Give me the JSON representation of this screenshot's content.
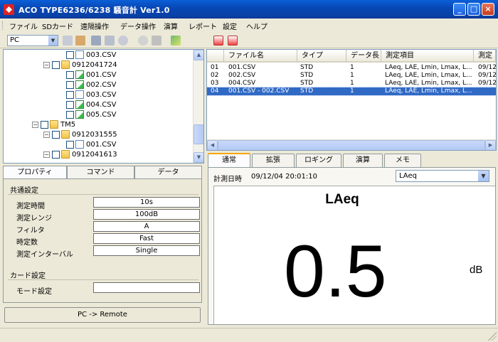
{
  "window": {
    "title": "ACO TYPE6236/6238 騒音計 Ver1.0",
    "min": "_",
    "max": "□",
    "close": "×"
  },
  "menu": [
    "ファイル",
    "SDカード",
    "遠隔操作",
    "データ操作",
    "演算",
    "レポート",
    "設定",
    "ヘルプ"
  ],
  "toolbar": {
    "source_select": "PC"
  },
  "tree": [
    {
      "label": "003.CSV",
      "type": "file",
      "level": 3
    },
    {
      "label": "0912041724",
      "type": "folder",
      "level": 2,
      "expander": "−"
    },
    {
      "label": "001.CSV",
      "type": "file-green",
      "level": 3
    },
    {
      "label": "002.CSV",
      "type": "file-green",
      "level": 3
    },
    {
      "label": "003.CSV",
      "type": "file",
      "level": 3
    },
    {
      "label": "004.CSV",
      "type": "file-green",
      "level": 3
    },
    {
      "label": "005.CSV",
      "type": "file-green",
      "level": 3
    },
    {
      "label": "TM5",
      "type": "folder",
      "level": 1,
      "expander": "−"
    },
    {
      "label": "0912031555",
      "type": "folder",
      "level": 2,
      "expander": "−"
    },
    {
      "label": "001.CSV",
      "type": "file",
      "level": 3
    },
    {
      "label": "0912041613",
      "type": "folder",
      "level": 2,
      "expander": "−"
    }
  ],
  "left_tabs": [
    "プロパティ",
    "コマンド",
    "データ"
  ],
  "properties": {
    "common_group": "共通設定",
    "rows": [
      {
        "label": "測定時間",
        "value": "10s"
      },
      {
        "label": "測定レンジ",
        "value": "100dB"
      },
      {
        "label": "フィルタ",
        "value": "A"
      },
      {
        "label": "時定数",
        "value": "Fast"
      },
      {
        "label": "測定インターバル",
        "value": "Single"
      }
    ],
    "card_group": "カード設定",
    "card_rows": [
      {
        "label": "モード設定",
        "value": ""
      }
    ]
  },
  "pc_remote_button": "PC -> Remote",
  "file_list": {
    "columns": [
      "",
      "ファイル名",
      "タイプ",
      "データ長",
      "測定項目",
      "測定"
    ],
    "rows": [
      {
        "no": "01",
        "name": "001.CSV",
        "type": "STD",
        "len": "1",
        "items": "LAeq, LAE, Lmin, Lmax, L...",
        "date": "09/12",
        "selected": false
      },
      {
        "no": "02",
        "name": "002.CSV",
        "type": "STD",
        "len": "1",
        "items": "LAeq, LAE, Lmin, Lmax, L...",
        "date": "09/12",
        "selected": false
      },
      {
        "no": "03",
        "name": "004.CSV",
        "type": "STD",
        "len": "1",
        "items": "LAeq, LAE, Lmin, Lmax, L...",
        "date": "09/12",
        "selected": false
      },
      {
        "no": "04",
        "name": "001.CSV - 002.CSV",
        "type": "STD",
        "len": "1",
        "items": "LAeq, LAE, Lmin, Lmax, L...",
        "date": "",
        "selected": true
      }
    ]
  },
  "right_tabs": [
    "通常",
    "拡張",
    "ロギング",
    "演算",
    "メモ"
  ],
  "measurement": {
    "datetime_label": "計測日時",
    "datetime_value": "09/12/04 20:01:10",
    "item_select": "LAeq",
    "display_title": "LAeq",
    "display_value": "0.5",
    "display_unit": "dB"
  }
}
